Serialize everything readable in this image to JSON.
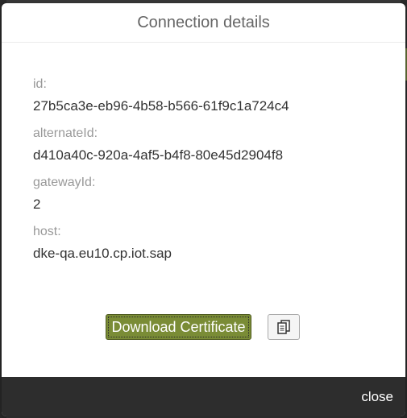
{
  "dialog": {
    "title": "Connection details",
    "fields": [
      {
        "label": "id:",
        "value": "27b5ca3e-eb96-4b58-b566-61f9c1a724c4"
      },
      {
        "label": "alternateId:",
        "value": "d410a40c-920a-4af5-b4f8-80e45d2904f8"
      },
      {
        "label": "gatewayId:",
        "value": "2"
      },
      {
        "label": "host:",
        "value": "dke-qa.eu10.cp.iot.sap"
      }
    ],
    "download_label": "Download Certificate",
    "copy_icon": "copy-icon",
    "close_label": "close"
  },
  "colors": {
    "accent_button": "#7a8c36",
    "footer": "#2d2d2d",
    "label": "#999999",
    "value": "#333333"
  }
}
